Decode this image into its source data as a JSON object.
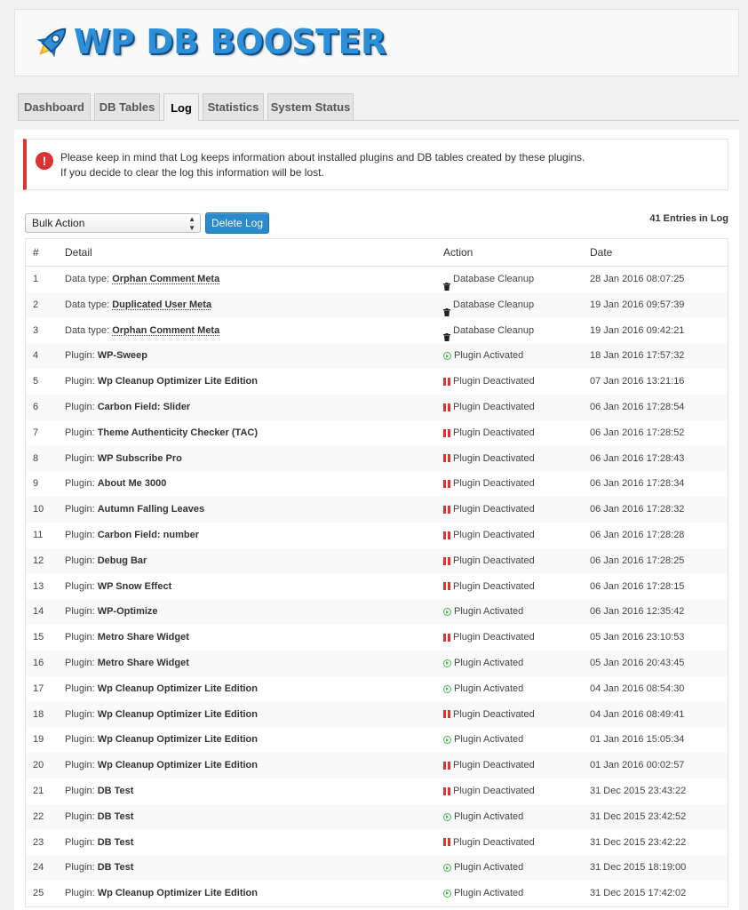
{
  "app": {
    "title": "WP DB BOOSTER"
  },
  "colors": {
    "accent": "#2a8bcc",
    "error": "#dc3232",
    "success": "#46b450",
    "logo": "#2d8fd8"
  },
  "tabs": [
    {
      "label": "Dashboard",
      "active": false
    },
    {
      "label": "DB Tables",
      "active": false
    },
    {
      "label": "Log",
      "active": true
    },
    {
      "label": "Statistics",
      "active": false
    },
    {
      "label": "System Status",
      "active": false
    }
  ],
  "notice": {
    "icon": "exclamation-icon",
    "line1": "Please keep in mind that Log keeps information about installed plugins and DB tables created by these plugins.",
    "line2": "If you decide to clear the log this information will be lost."
  },
  "toolbar": {
    "bulk_action_value": "Bulk Action",
    "delete_label": "Delete Log",
    "entries_count": "41 Entries in Log"
  },
  "table": {
    "headers": {
      "num": "#",
      "detail": "Detail",
      "action": "Action",
      "date": "Date"
    },
    "rows": [
      {
        "num": "1",
        "label": "Data type:",
        "value": "Orphan Comment Meta",
        "link": true,
        "action": "Database Cleanup",
        "icon": "trash-icon",
        "date": "28 Jan 2016 08:07:25"
      },
      {
        "num": "2",
        "label": "Data type:",
        "value": "Duplicated User Meta",
        "link": true,
        "action": "Database Cleanup",
        "icon": "trash-icon",
        "date": "19 Jan 2016 09:57:39"
      },
      {
        "num": "3",
        "label": "Data type:",
        "value": "Orphan Comment Meta",
        "link": true,
        "action": "Database Cleanup",
        "icon": "trash-icon",
        "date": "19 Jan 2016 09:42:21"
      },
      {
        "num": "4",
        "label": "Plugin:",
        "value": "WP-Sweep",
        "link": false,
        "action": "Plugin Activated",
        "icon": "play-icon",
        "date": "18 Jan 2016 17:57:32"
      },
      {
        "num": "5",
        "label": "Plugin:",
        "value": "Wp Cleanup Optimizer Lite Edition",
        "link": false,
        "action": "Plugin Deactivated",
        "icon": "pause-icon",
        "date": "07 Jan 2016 13:21:16"
      },
      {
        "num": "6",
        "label": "Plugin:",
        "value": "Carbon Field: Slider",
        "link": false,
        "action": "Plugin Deactivated",
        "icon": "pause-icon",
        "date": "06 Jan 2016 17:28:54"
      },
      {
        "num": "7",
        "label": "Plugin:",
        "value": "Theme Authenticity Checker (TAC)",
        "link": false,
        "action": "Plugin Deactivated",
        "icon": "pause-icon",
        "date": "06 Jan 2016 17:28:52"
      },
      {
        "num": "8",
        "label": "Plugin:",
        "value": "WP Subscribe Pro",
        "link": false,
        "action": "Plugin Deactivated",
        "icon": "pause-icon",
        "date": "06 Jan 2016 17:28:43"
      },
      {
        "num": "9",
        "label": "Plugin:",
        "value": "About Me 3000",
        "link": false,
        "action": "Plugin Deactivated",
        "icon": "pause-icon",
        "date": "06 Jan 2016 17:28:34"
      },
      {
        "num": "10",
        "label": "Plugin:",
        "value": "Autumn Falling Leaves",
        "link": false,
        "action": "Plugin Deactivated",
        "icon": "pause-icon",
        "date": "06 Jan 2016 17:28:32"
      },
      {
        "num": "11",
        "label": "Plugin:",
        "value": "Carbon Field: number",
        "link": false,
        "action": "Plugin Deactivated",
        "icon": "pause-icon",
        "date": "06 Jan 2016 17:28:28"
      },
      {
        "num": "12",
        "label": "Plugin:",
        "value": "Debug Bar",
        "link": false,
        "action": "Plugin Deactivated",
        "icon": "pause-icon",
        "date": "06 Jan 2016 17:28:25"
      },
      {
        "num": "13",
        "label": "Plugin:",
        "value": "WP Snow Effect",
        "link": false,
        "action": "Plugin Deactivated",
        "icon": "pause-icon",
        "date": "06 Jan 2016 17:28:15"
      },
      {
        "num": "14",
        "label": "Plugin:",
        "value": "WP-Optimize",
        "link": false,
        "action": "Plugin Activated",
        "icon": "play-icon",
        "date": "06 Jan 2016 12:35:42"
      },
      {
        "num": "15",
        "label": "Plugin:",
        "value": "Metro Share Widget",
        "link": false,
        "action": "Plugin Deactivated",
        "icon": "pause-icon",
        "date": "05 Jan 2016 23:10:53"
      },
      {
        "num": "16",
        "label": "Plugin:",
        "value": "Metro Share Widget",
        "link": false,
        "action": "Plugin Activated",
        "icon": "play-icon",
        "date": "05 Jan 2016 20:43:45"
      },
      {
        "num": "17",
        "label": "Plugin:",
        "value": "Wp Cleanup Optimizer Lite Edition",
        "link": false,
        "action": "Plugin Activated",
        "icon": "play-icon",
        "date": "04 Jan 2016 08:54:30"
      },
      {
        "num": "18",
        "label": "Plugin:",
        "value": "Wp Cleanup Optimizer Lite Edition",
        "link": false,
        "action": "Plugin Deactivated",
        "icon": "pause-icon",
        "date": "04 Jan 2016 08:49:41"
      },
      {
        "num": "19",
        "label": "Plugin:",
        "value": "Wp Cleanup Optimizer Lite Edition",
        "link": false,
        "action": "Plugin Activated",
        "icon": "play-icon",
        "date": "01 Jan 2016 15:05:34"
      },
      {
        "num": "20",
        "label": "Plugin:",
        "value": "Wp Cleanup Optimizer Lite Edition",
        "link": false,
        "action": "Plugin Deactivated",
        "icon": "pause-icon",
        "date": "01 Jan 2016 00:02:57"
      },
      {
        "num": "21",
        "label": "Plugin:",
        "value": "DB Test",
        "link": false,
        "action": "Plugin Deactivated",
        "icon": "pause-icon",
        "date": "31 Dec 2015 23:43:22"
      },
      {
        "num": "22",
        "label": "Plugin:",
        "value": "DB Test",
        "link": false,
        "action": "Plugin Activated",
        "icon": "play-icon",
        "date": "31 Dec 2015 23:42:52"
      },
      {
        "num": "23",
        "label": "Plugin:",
        "value": "DB Test",
        "link": false,
        "action": "Plugin Deactivated",
        "icon": "pause-icon",
        "date": "31 Dec 2015 23:42:22"
      },
      {
        "num": "24",
        "label": "Plugin:",
        "value": "DB Test",
        "link": false,
        "action": "Plugin Activated",
        "icon": "play-icon",
        "date": "31 Dec 2015 18:19:00"
      },
      {
        "num": "25",
        "label": "Plugin:",
        "value": "Wp Cleanup Optimizer Lite Edition",
        "link": false,
        "action": "Plugin Activated",
        "icon": "play-icon",
        "date": "31 Dec 2015 17:42:02"
      }
    ]
  }
}
